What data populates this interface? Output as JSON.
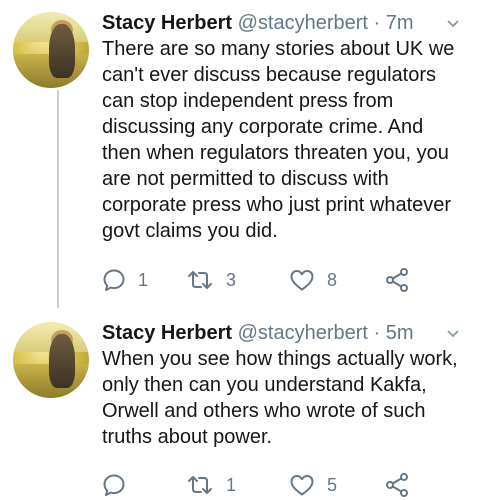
{
  "tweets": [
    {
      "name": "Stacy Herbert",
      "handle": "@stacyherbert",
      "separator": "·",
      "time": "7m",
      "text": "There are so many stories about UK we\ncan't ever discuss because regulators\ncan stop independent press from\ndiscussing any corporate crime. And\nthen when regulators threaten you, you\nare not permitted to discuss with\ncorporate press who just print whatever\ngovt claims you did.",
      "replies": "1",
      "retweets": "3",
      "likes": "8"
    },
    {
      "name": "Stacy Herbert",
      "handle": "@stacyherbert",
      "separator": "·",
      "time": "5m",
      "text": "When you see how things actually work,\nonly then can you understand Kakfa,\nOrwell and others who wrote of such\ntruths about power.",
      "replies": "",
      "retweets": "1",
      "likes": "5"
    }
  ],
  "icons": {
    "reply": "reply-icon",
    "retweet": "retweet-icon",
    "like": "heart-icon",
    "share": "share-icon",
    "menu": "chevron-down-icon"
  },
  "colors": {
    "secondary_text": "#657786",
    "primary_text": "#14171a",
    "thread_line": "#c4cfd6"
  }
}
